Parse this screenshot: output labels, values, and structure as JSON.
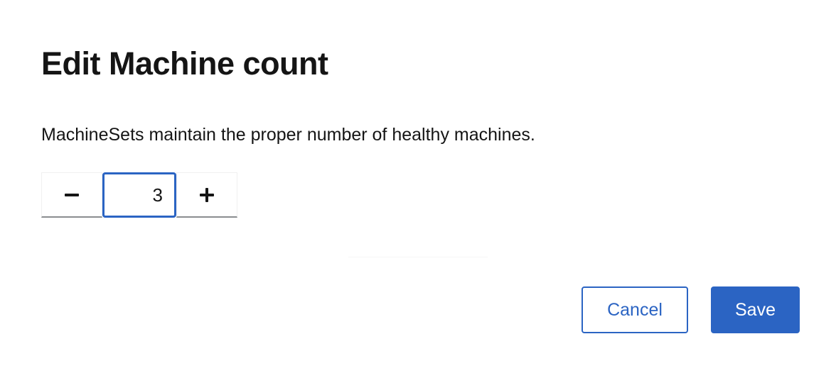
{
  "modal": {
    "title": "Edit Machine count",
    "description": "MachineSets maintain the proper number of healthy machines."
  },
  "stepper": {
    "value": "3",
    "decrement_icon": "minus-icon",
    "increment_icon": "plus-icon"
  },
  "actions": {
    "cancel_label": "Cancel",
    "save_label": "Save"
  },
  "colors": {
    "primary": "#2b64c3",
    "text": "#151515",
    "border": "#8a8d90"
  }
}
